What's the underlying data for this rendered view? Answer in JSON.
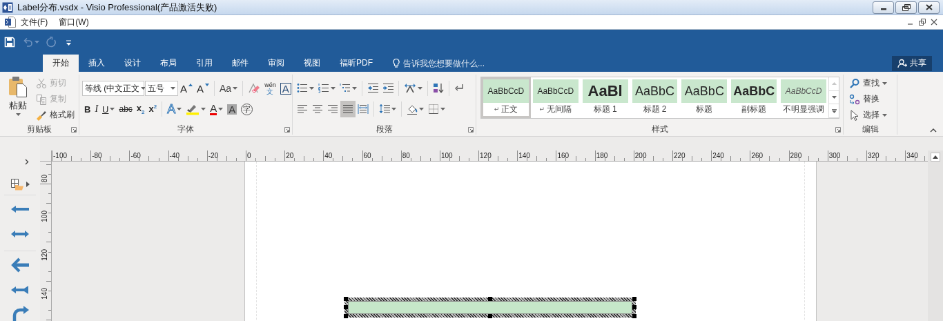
{
  "window": {
    "title": "Label分布.vsdx - Visio Professional(产品激活失败)"
  },
  "menu_bar": {
    "items": [
      "文件(F)",
      "窗口(W)"
    ]
  },
  "quick_access": {
    "buttons": [
      {
        "kind": "save",
        "disabled": false
      },
      {
        "kind": "undo",
        "disabled": true
      },
      {
        "kind": "redo",
        "disabled": true
      },
      {
        "kind": "customize",
        "disabled": false
      }
    ]
  },
  "tabs": [
    {
      "label": "开始",
      "selected": true
    },
    {
      "label": "插入",
      "selected": false
    },
    {
      "label": "设计",
      "selected": false
    },
    {
      "label": "布局",
      "selected": false
    },
    {
      "label": "引用",
      "selected": false
    },
    {
      "label": "邮件",
      "selected": false
    },
    {
      "label": "审阅",
      "selected": false
    },
    {
      "label": "视图",
      "selected": false
    },
    {
      "label": "福昕PDF",
      "selected": false
    }
  ],
  "tell_me": {
    "placeholder": "告诉我您想要做什么..."
  },
  "share_button": "共享",
  "clipboard": {
    "title": "剪贴板",
    "paste": "粘贴",
    "commands": [
      {
        "kind": "cut",
        "label": "剪切",
        "disabled": true
      },
      {
        "kind": "copy",
        "label": "复制",
        "disabled": true
      },
      {
        "kind": "format_painter",
        "label": "格式刷",
        "disabled": false
      }
    ]
  },
  "font": {
    "title": "字体",
    "font_name": "等线 (中文正文",
    "font_size": "五号",
    "row_1": [
      {
        "kind": "grow",
        "glyph": "A"
      },
      {
        "kind": "shrink",
        "glyph": "A"
      },
      {
        "kind": "case",
        "glyph": "Aa",
        "dropdown": true,
        "divider_before": true
      },
      {
        "kind": "clear",
        "divider_before": true
      },
      {
        "kind": "phonetic",
        "glyph": "wén",
        "glyph_2": "文"
      },
      {
        "kind": "boxed",
        "glyph": "A"
      }
    ],
    "row_2": [
      {
        "kind": "bold",
        "glyph": "B"
      },
      {
        "kind": "italic",
        "glyph": "I"
      },
      {
        "kind": "underline",
        "glyph": "U",
        "dropdown": true
      },
      {
        "kind": "strike",
        "glyph": "abc"
      },
      {
        "kind": "sub",
        "glyph": "x$_{2}$"
      },
      {
        "kind": "sup",
        "glyph": "x$^{2}$"
      },
      {
        "kind": "effect",
        "glyph": "A",
        "dropdown": true,
        "divider_before": true
      },
      {
        "kind": "highlight",
        "dropdown": true
      },
      {
        "kind": "color",
        "glyph": "A",
        "dropdown": true
      },
      {
        "kind": "shade",
        "glyph": "A"
      },
      {
        "kind": "enclose",
        "glyph": "字"
      }
    ]
  },
  "paragraph": {
    "title": "段落",
    "alignments": [
      {
        "kind": "left",
        "selected": false
      },
      {
        "kind": "center",
        "selected": false
      },
      {
        "kind": "right",
        "selected": false
      },
      {
        "kind": "justify",
        "selected": true
      },
      {
        "kind": "distributed",
        "selected": false
      }
    ]
  },
  "styles": {
    "title": "样式",
    "items": [
      {
        "kind": "normal",
        "preview": "AaBbCcD",
        "mark": "↵",
        "label": "正文",
        "selected": true
      },
      {
        "kind": "no_spacing",
        "preview": "AaBbCcD",
        "mark": "↵",
        "label": "无间隔",
        "selected": false
      },
      {
        "kind": "heading_1",
        "preview": "AaBl",
        "label": "标题 1",
        "selected": false
      },
      {
        "kind": "heading_2",
        "preview": "AaBbC",
        "label": "标题 2",
        "selected": false
      },
      {
        "kind": "title",
        "preview": "AaBbC",
        "label": "标题",
        "selected": false
      },
      {
        "kind": "subtitle",
        "preview": "AaBbC",
        "label": "副标题",
        "selected": false
      },
      {
        "kind": "subtle_emphasis",
        "preview": "AaBbCcD",
        "label": "不明显强调",
        "selected": false
      }
    ]
  },
  "editing": {
    "title": "编辑",
    "commands": [
      {
        "kind": "find",
        "label": "查找",
        "dropdown": true
      },
      {
        "kind": "replace",
        "label": "替换",
        "dropdown": false
      },
      {
        "kind": "select",
        "label": "选择",
        "dropdown": true
      }
    ]
  },
  "rulers": {
    "horizontal": [
      "-100",
      "-80",
      "-60",
      "-40",
      "-20",
      "0",
      "20",
      "40",
      "60",
      "80",
      "100",
      "120",
      "140",
      "160",
      "180",
      "200",
      "220",
      "240",
      "260",
      "280",
      "300",
      "320",
      "340"
    ],
    "vertical": [
      "80",
      "100",
      "120",
      "140"
    ]
  },
  "page": {
    "shapes": [
      {
        "kind": "rectangle",
        "selected": true
      }
    ]
  }
}
